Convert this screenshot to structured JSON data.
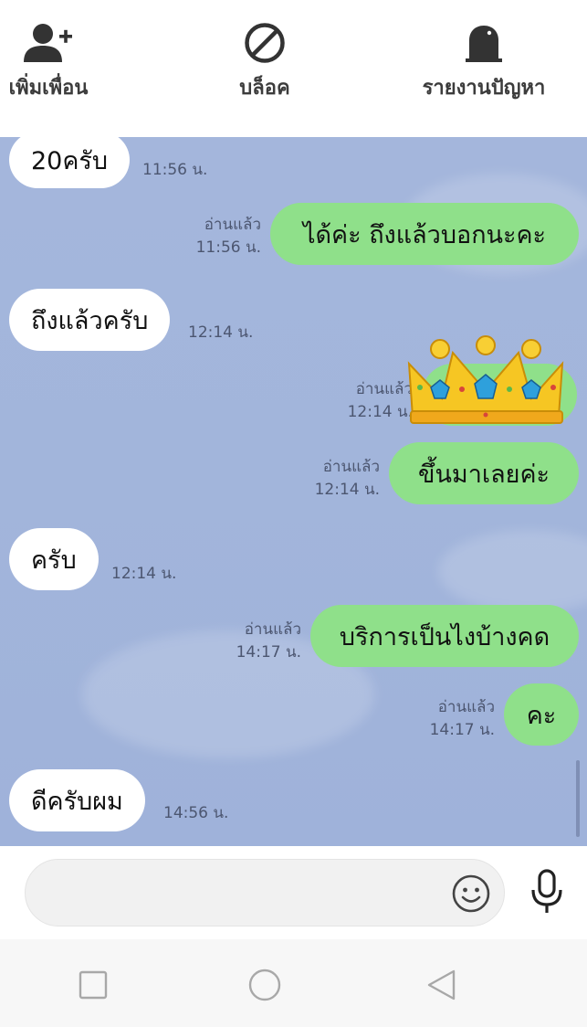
{
  "actions": {
    "add_friend": "เพิ่มเพื่อน",
    "block": "บล็อค",
    "report": "รายงานปัญหา"
  },
  "messages": [
    {
      "dir": "in",
      "text": "20ครับ",
      "time": "11:56 น."
    },
    {
      "dir": "out",
      "text": "ได้ค่ะ ถึงแล้วบอกนะคะ",
      "read": "อ่านแล้ว",
      "time": "11:56 น."
    },
    {
      "dir": "in",
      "text": "ถึงแล้วครับ",
      "time": "12:14 น."
    },
    {
      "dir": "out",
      "sticker": "crown-sticker",
      "read": "อ่านแล้ว",
      "time": "12:14 น."
    },
    {
      "dir": "out",
      "text": "ขึ้นมาเลยค่ะ",
      "read": "อ่านแล้ว",
      "time": "12:14 น."
    },
    {
      "dir": "in",
      "text": "ครับ",
      "time": "12:14 น."
    },
    {
      "dir": "out",
      "text": "บริการเป็นไงบ้างคด",
      "read": "อ่านแล้ว",
      "time": "14:17 น."
    },
    {
      "dir": "out",
      "text": "คะ",
      "read": "อ่านแล้ว",
      "time": "14:17 น."
    },
    {
      "dir": "in",
      "text": "ดีครับผม",
      "time": "14:56 น."
    }
  ],
  "composer": {
    "value": "",
    "placeholder": ""
  },
  "colors": {
    "chat_background": "#a2b5db",
    "outgoing_bubble": "#8fe08a",
    "incoming_bubble": "#ffffff"
  },
  "icons": [
    "add-friend-icon",
    "block-icon",
    "report-icon",
    "emoji-icon",
    "microphone-icon",
    "recent-apps-icon",
    "home-icon",
    "back-icon"
  ]
}
